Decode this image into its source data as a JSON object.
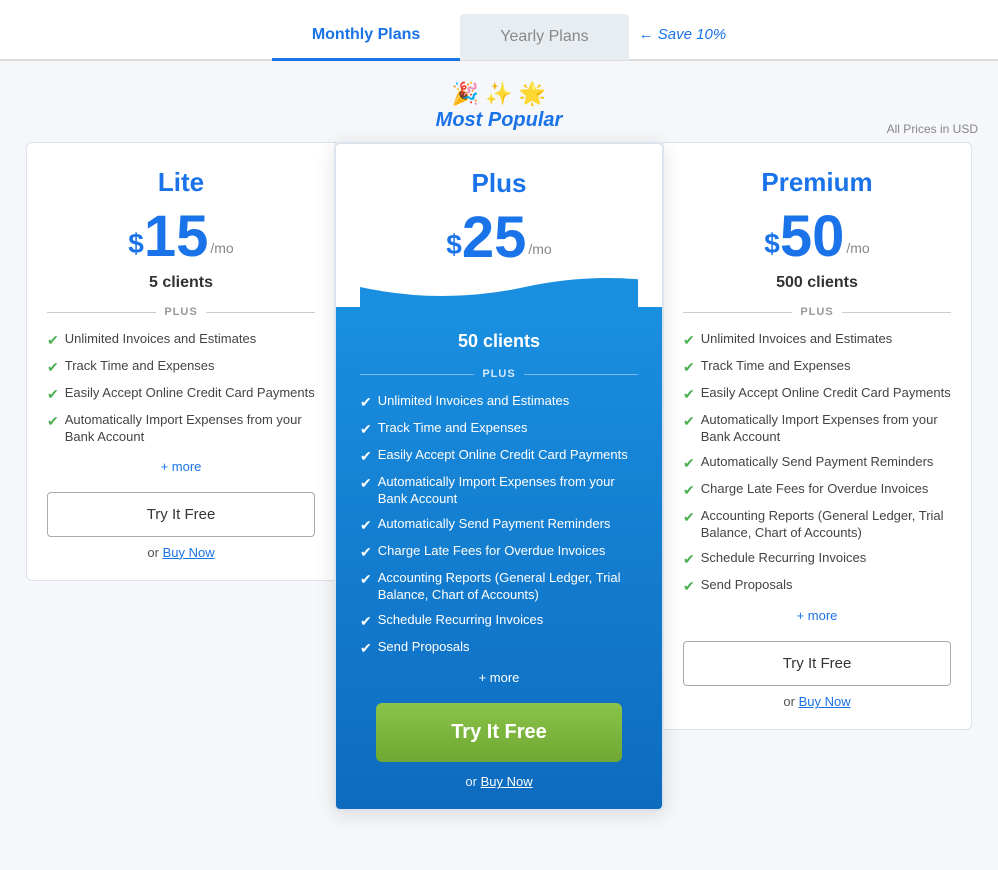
{
  "tabs": {
    "monthly": {
      "label": "Monthly Plans"
    },
    "yearly": {
      "label": "Yearly Plans"
    },
    "save_label": "← Save 10%"
  },
  "popular_badge": {
    "confetti": "✦ ✦ ✦",
    "text": "Most Popular"
  },
  "usd_note": "All Prices in USD",
  "plans": {
    "lite": {
      "name": "Lite",
      "price_symbol": "$",
      "price": "15",
      "period": "/mo",
      "clients": "5 clients",
      "plus_label": "PLUS",
      "features": [
        "Unlimited Invoices and Estimates",
        "Track Time and Expenses",
        "Easily Accept Online Credit Card Payments",
        "Automatically Import Expenses from your Bank Account"
      ],
      "more_link": "+ more",
      "try_free_label": "Try It Free",
      "or_text": "or",
      "buy_now_label": "Buy Now"
    },
    "plus": {
      "name": "Plus",
      "price_symbol": "$",
      "price": "25",
      "period": "/mo",
      "clients": "50 clients",
      "plus_label": "PLUS",
      "features": [
        "Unlimited Invoices and Estimates",
        "Track Time and Expenses",
        "Easily Accept Online Credit Card Payments",
        "Automatically Import Expenses from your Bank Account",
        "Automatically Send Payment Reminders",
        "Charge Late Fees for Overdue Invoices",
        "Accounting Reports (General Ledger, Trial Balance, Chart of Accounts)",
        "Schedule Recurring Invoices",
        "Send Proposals"
      ],
      "more_link": "+ more",
      "try_free_label": "Try It Free",
      "or_text": "or",
      "buy_now_label": "Buy Now"
    },
    "premium": {
      "name": "Premium",
      "price_symbol": "$",
      "price": "50",
      "period": "/mo",
      "clients": "500 clients",
      "plus_label": "PLUS",
      "features": [
        "Unlimited Invoices and Estimates",
        "Track Time and Expenses",
        "Easily Accept Online Credit Card Payments",
        "Automatically Import Expenses from your Bank Account",
        "Automatically Send Payment Reminders",
        "Charge Late Fees for Overdue Invoices",
        "Accounting Reports (General Ledger, Trial Balance, Chart of Accounts)",
        "Schedule Recurring Invoices",
        "Send Proposals"
      ],
      "more_link": "+ more",
      "try_free_label": "Try It Free",
      "or_text": "or",
      "buy_now_label": "Buy Now"
    }
  }
}
